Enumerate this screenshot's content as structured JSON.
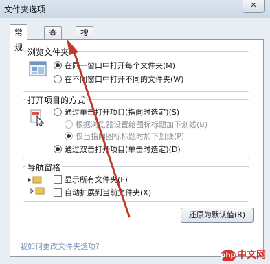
{
  "window": {
    "title": "文件夹选项",
    "close_label": "✕"
  },
  "tabs": [
    {
      "label": "常规",
      "active": true
    },
    {
      "label": "查看",
      "active": false
    },
    {
      "label": "搜索",
      "active": false
    }
  ],
  "browse": {
    "label": "浏览文件夹",
    "options": [
      {
        "label": "在同一窗口中打开每个文件夹(M)",
        "selected": true
      },
      {
        "label": "在不同窗口中打开不同的文件夹(W)",
        "selected": false
      }
    ]
  },
  "open_items": {
    "label": "打开项目的方式",
    "options": [
      {
        "label": "通过单击打开项目(指向时选定)(S)",
        "selected": false
      },
      {
        "label": "根据浏览器设置给图标标题加下划线(B)",
        "selected": false,
        "disabled": true
      },
      {
        "label": "仅当指向图标标题时加下划线(P)",
        "selected": true,
        "disabled": true
      },
      {
        "label": "通过双击打开项目(单击时选定)(D)",
        "selected": true
      }
    ]
  },
  "nav_pane": {
    "label": "导航窗格",
    "options": [
      {
        "label": "显示所有文件夹(F)",
        "checked": false
      },
      {
        "label": "自动扩展到当前文件夹(X)",
        "checked": false
      }
    ]
  },
  "restore_button": "还原为默认值(R)",
  "help_link": "我如何更改文件夹选项?",
  "watermark": {
    "badge": "php",
    "text": "中文网"
  },
  "colors": {
    "arrow": "#c0392b",
    "accent": "#2c3440"
  }
}
